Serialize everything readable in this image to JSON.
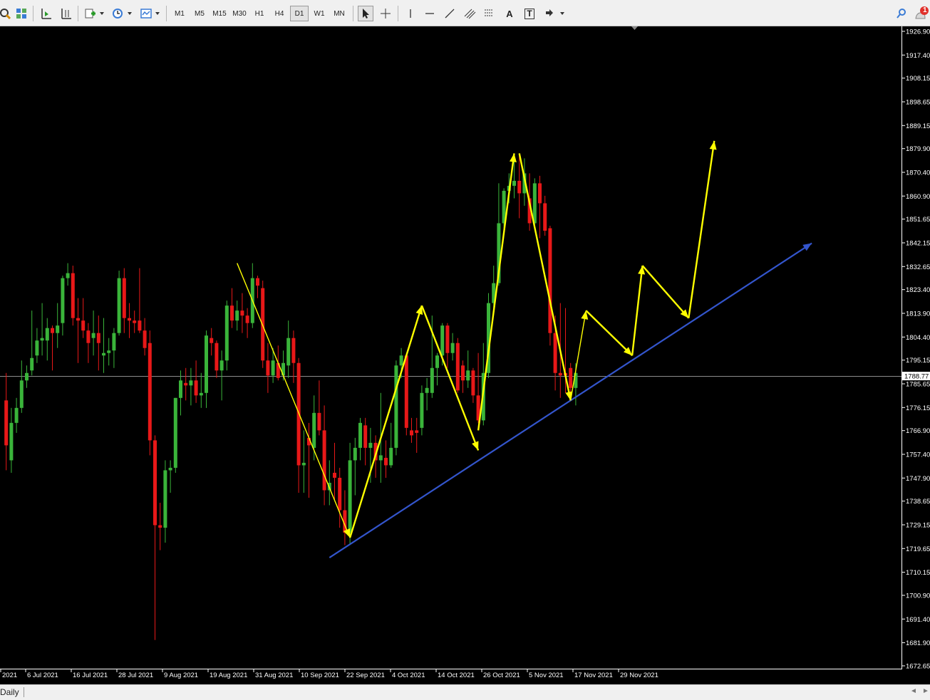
{
  "toolbar": {
    "timeframes": [
      "M1",
      "M5",
      "M15",
      "M30",
      "H1",
      "H4",
      "D1",
      "W1",
      "MN"
    ],
    "active_timeframe": "D1",
    "text_tool": "A",
    "label_tool": "T",
    "notification_count": "1"
  },
  "status": {
    "tab_label": "Daily"
  },
  "colors": {
    "background": "#000000",
    "bull": "#3ab43a",
    "bear": "#e81818",
    "arrows": "#ffff00",
    "trendline": "#3355cc",
    "grid_line": "#bbbbbb"
  },
  "chart_data": {
    "type": "candlestick",
    "x_axis_labels": [
      "2021",
      "6 Jul 2021",
      "16 Jul 2021",
      "28 Jul 2021",
      "9 Aug 2021",
      "19 Aug 2021",
      "31 Aug 2021",
      "10 Sep 2021",
      "22 Sep 2021",
      "4 Oct 2021",
      "14 Oct 2021",
      "26 Oct 2021",
      "5 Nov 2021",
      "17 Nov 2021",
      "29 Nov 2021"
    ],
    "y_axis_ticks": [
      "1926.90",
      "1917.40",
      "1908.15",
      "1898.65",
      "1889.15",
      "1879.90",
      "1870.40",
      "1860.90",
      "1851.65",
      "1842.15",
      "1832.65",
      "1823.40",
      "1813.90",
      "1804.40",
      "1795.15",
      "1785.65",
      "1776.15",
      "1766.90",
      "1757.40",
      "1747.90",
      "1738.65",
      "1729.15",
      "1719.65",
      "1710.15",
      "1700.90",
      "1691.40",
      "1681.90",
      "1672.65"
    ],
    "ylim": [
      1672.65,
      1926.9
    ],
    "current_price": "1788.77",
    "candles": [
      {
        "x": "2021-06-29",
        "o": 1779,
        "h": 1790,
        "l": 1751,
        "c": 1761
      },
      {
        "x": "2021-06-30",
        "o": 1755,
        "h": 1776,
        "l": 1750,
        "c": 1770
      },
      {
        "x": "2021-07-01",
        "o": 1770,
        "h": 1780,
        "l": 1766,
        "c": 1776
      },
      {
        "x": "2021-07-02",
        "o": 1776,
        "h": 1795,
        "l": 1774,
        "c": 1787
      },
      {
        "x": "2021-07-05",
        "o": 1787,
        "h": 1793,
        "l": 1784,
        "c": 1790
      },
      {
        "x": "2021-07-06",
        "o": 1791,
        "h": 1815,
        "l": 1789,
        "c": 1796
      },
      {
        "x": "2021-07-07",
        "o": 1797,
        "h": 1808,
        "l": 1794,
        "c": 1803
      },
      {
        "x": "2021-07-08",
        "o": 1803,
        "h": 1818,
        "l": 1797,
        "c": 1804
      },
      {
        "x": "2021-07-09",
        "o": 1803,
        "h": 1812,
        "l": 1795,
        "c": 1808
      },
      {
        "x": "2021-07-12",
        "o": 1808,
        "h": 1809,
        "l": 1791,
        "c": 1806
      },
      {
        "x": "2021-07-13",
        "o": 1806,
        "h": 1818,
        "l": 1800,
        "c": 1809
      },
      {
        "x": "2021-07-14",
        "o": 1810,
        "h": 1829,
        "l": 1805,
        "c": 1828
      },
      {
        "x": "2021-07-15",
        "o": 1828,
        "h": 1834,
        "l": 1825,
        "c": 1830
      },
      {
        "x": "2021-07-16",
        "o": 1830,
        "h": 1833,
        "l": 1809,
        "c": 1812
      },
      {
        "x": "2021-07-19",
        "o": 1812,
        "h": 1820,
        "l": 1794,
        "c": 1811
      },
      {
        "x": "2021-07-20",
        "o": 1811,
        "h": 1820,
        "l": 1804,
        "c": 1807
      },
      {
        "x": "2021-07-21",
        "o": 1807,
        "h": 1810,
        "l": 1794,
        "c": 1802
      },
      {
        "x": "2021-07-22",
        "o": 1804,
        "h": 1815,
        "l": 1797,
        "c": 1806
      },
      {
        "x": "2021-07-23",
        "o": 1806,
        "h": 1813,
        "l": 1791,
        "c": 1802
      },
      {
        "x": "2021-07-26",
        "o": 1797,
        "h": 1812,
        "l": 1790,
        "c": 1798
      },
      {
        "x": "2021-07-27",
        "o": 1798,
        "h": 1804,
        "l": 1793,
        "c": 1799
      },
      {
        "x": "2021-07-28",
        "o": 1799,
        "h": 1808,
        "l": 1792,
        "c": 1806
      },
      {
        "x": "2021-07-29",
        "o": 1806,
        "h": 1831,
        "l": 1805,
        "c": 1828
      },
      {
        "x": "2021-07-30",
        "o": 1828,
        "h": 1832,
        "l": 1806,
        "c": 1812
      },
      {
        "x": "2021-08-02",
        "o": 1812,
        "h": 1818,
        "l": 1804,
        "c": 1811
      },
      {
        "x": "2021-08-03",
        "o": 1811,
        "h": 1815,
        "l": 1806,
        "c": 1810
      },
      {
        "x": "2021-08-04",
        "o": 1811,
        "h": 1832,
        "l": 1806,
        "c": 1807
      },
      {
        "x": "2021-08-05",
        "o": 1807,
        "h": 1812,
        "l": 1797,
        "c": 1800
      },
      {
        "x": "2021-08-06",
        "o": 1802,
        "h": 1807,
        "l": 1757,
        "c": 1763
      },
      {
        "x": "2021-08-09",
        "o": 1763,
        "h": 1765,
        "l": 1683,
        "c": 1729
      },
      {
        "x": "2021-08-10",
        "o": 1729,
        "h": 1738,
        "l": 1719,
        "c": 1728
      },
      {
        "x": "2021-08-11",
        "o": 1728,
        "h": 1755,
        "l": 1722,
        "c": 1751
      },
      {
        "x": "2021-08-12",
        "o": 1751,
        "h": 1755,
        "l": 1742,
        "c": 1752
      },
      {
        "x": "2021-08-13",
        "o": 1752,
        "h": 1780,
        "l": 1750,
        "c": 1780
      },
      {
        "x": "2021-08-16",
        "o": 1780,
        "h": 1791,
        "l": 1773,
        "c": 1787
      },
      {
        "x": "2021-08-17",
        "o": 1786,
        "h": 1792,
        "l": 1779,
        "c": 1785
      },
      {
        "x": "2021-08-18",
        "o": 1785,
        "h": 1792,
        "l": 1777,
        "c": 1787
      },
      {
        "x": "2021-08-19",
        "o": 1787,
        "h": 1795,
        "l": 1778,
        "c": 1781
      },
      {
        "x": "2021-08-20",
        "o": 1781,
        "h": 1790,
        "l": 1776,
        "c": 1782
      },
      {
        "x": "2021-08-23",
        "o": 1782,
        "h": 1807,
        "l": 1776,
        "c": 1805
      },
      {
        "x": "2021-08-24",
        "o": 1804,
        "h": 1808,
        "l": 1797,
        "c": 1802
      },
      {
        "x": "2021-08-25",
        "o": 1802,
        "h": 1803,
        "l": 1788,
        "c": 1791
      },
      {
        "x": "2021-08-26",
        "o": 1791,
        "h": 1799,
        "l": 1779,
        "c": 1795
      },
      {
        "x": "2021-08-27",
        "o": 1795,
        "h": 1819,
        "l": 1791,
        "c": 1817
      },
      {
        "x": "2021-08-30",
        "o": 1817,
        "h": 1824,
        "l": 1808,
        "c": 1811
      },
      {
        "x": "2021-08-31",
        "o": 1811,
        "h": 1819,
        "l": 1807,
        "c": 1815
      },
      {
        "x": "2021-09-01",
        "o": 1815,
        "h": 1822,
        "l": 1806,
        "c": 1813
      },
      {
        "x": "2021-09-02",
        "o": 1813,
        "h": 1816,
        "l": 1804,
        "c": 1810
      },
      {
        "x": "2021-09-03",
        "o": 1810,
        "h": 1834,
        "l": 1808,
        "c": 1828
      },
      {
        "x": "2021-09-06",
        "o": 1828,
        "h": 1829,
        "l": 1820,
        "c": 1825
      },
      {
        "x": "2021-09-07",
        "o": 1824,
        "h": 1827,
        "l": 1792,
        "c": 1795
      },
      {
        "x": "2021-09-08",
        "o": 1795,
        "h": 1802,
        "l": 1782,
        "c": 1789
      },
      {
        "x": "2021-09-09",
        "o": 1789,
        "h": 1800,
        "l": 1786,
        "c": 1795
      },
      {
        "x": "2021-09-10",
        "o": 1794,
        "h": 1801,
        "l": 1787,
        "c": 1788
      },
      {
        "x": "2021-09-13",
        "o": 1789,
        "h": 1799,
        "l": 1787,
        "c": 1794
      },
      {
        "x": "2021-09-14",
        "o": 1793,
        "h": 1811,
        "l": 1788,
        "c": 1804
      },
      {
        "x": "2021-09-15",
        "o": 1804,
        "h": 1807,
        "l": 1786,
        "c": 1794
      },
      {
        "x": "2021-09-16",
        "o": 1794,
        "h": 1796,
        "l": 1742,
        "c": 1753
      },
      {
        "x": "2021-09-17",
        "o": 1753,
        "h": 1767,
        "l": 1742,
        "c": 1754
      },
      {
        "x": "2021-09-20",
        "o": 1764,
        "h": 1770,
        "l": 1740,
        "c": 1761
      },
      {
        "x": "2021-09-21",
        "o": 1760,
        "h": 1781,
        "l": 1755,
        "c": 1774
      },
      {
        "x": "2021-09-22",
        "o": 1774,
        "h": 1787,
        "l": 1765,
        "c": 1767
      },
      {
        "x": "2021-09-23",
        "o": 1767,
        "h": 1777,
        "l": 1737,
        "c": 1743
      },
      {
        "x": "2021-09-24",
        "o": 1743,
        "h": 1755,
        "l": 1737,
        "c": 1746
      },
      {
        "x": "2021-09-27",
        "o": 1750,
        "h": 1762,
        "l": 1739,
        "c": 1748
      },
      {
        "x": "2021-09-28",
        "o": 1748,
        "h": 1752,
        "l": 1728,
        "c": 1735
      },
      {
        "x": "2021-09-29",
        "o": 1735,
        "h": 1743,
        "l": 1721,
        "c": 1726
      },
      {
        "x": "2021-09-30",
        "o": 1726,
        "h": 1762,
        "l": 1721,
        "c": 1755
      },
      {
        "x": "2021-10-01",
        "o": 1755,
        "h": 1764,
        "l": 1741,
        "c": 1760
      },
      {
        "x": "2021-10-04",
        "o": 1760,
        "h": 1772,
        "l": 1755,
        "c": 1770
      },
      {
        "x": "2021-10-05",
        "o": 1769,
        "h": 1772,
        "l": 1753,
        "c": 1760
      },
      {
        "x": "2021-10-06",
        "o": 1760,
        "h": 1768,
        "l": 1746,
        "c": 1762
      },
      {
        "x": "2021-10-07",
        "o": 1762,
        "h": 1765,
        "l": 1748,
        "c": 1755
      },
      {
        "x": "2021-10-08",
        "o": 1755,
        "h": 1782,
        "l": 1746,
        "c": 1757
      },
      {
        "x": "2021-10-11",
        "o": 1756,
        "h": 1763,
        "l": 1748,
        "c": 1753
      },
      {
        "x": "2021-10-12",
        "o": 1753,
        "h": 1770,
        "l": 1752,
        "c": 1760
      },
      {
        "x": "2021-10-13",
        "o": 1760,
        "h": 1795,
        "l": 1757,
        "c": 1793
      },
      {
        "x": "2021-10-14",
        "o": 1793,
        "h": 1800,
        "l": 1788,
        "c": 1797
      },
      {
        "x": "2021-10-15",
        "o": 1797,
        "h": 1798,
        "l": 1765,
        "c": 1768
      },
      {
        "x": "2021-10-18",
        "o": 1767,
        "h": 1772,
        "l": 1762,
        "c": 1765
      },
      {
        "x": "2021-10-19",
        "o": 1767,
        "h": 1772,
        "l": 1758,
        "c": 1766
      },
      {
        "x": "2021-10-20",
        "o": 1768,
        "h": 1785,
        "l": 1765,
        "c": 1782
      },
      {
        "x": "2021-10-21",
        "o": 1782,
        "h": 1788,
        "l": 1775,
        "c": 1784
      },
      {
        "x": "2021-10-22",
        "o": 1782,
        "h": 1813,
        "l": 1780,
        "c": 1792
      },
      {
        "x": "2021-10-25",
        "o": 1792,
        "h": 1798,
        "l": 1785,
        "c": 1797
      },
      {
        "x": "2021-10-26",
        "o": 1797,
        "h": 1810,
        "l": 1793,
        "c": 1809
      },
      {
        "x": "2021-10-27",
        "o": 1809,
        "h": 1810,
        "l": 1792,
        "c": 1798
      },
      {
        "x": "2021-10-28",
        "o": 1798,
        "h": 1806,
        "l": 1795,
        "c": 1802
      },
      {
        "x": "2021-10-29",
        "o": 1802,
        "h": 1804,
        "l": 1782,
        "c": 1783
      },
      {
        "x": "2021-11-01",
        "o": 1793,
        "h": 1795,
        "l": 1782,
        "c": 1787
      },
      {
        "x": "2021-11-02",
        "o": 1787,
        "h": 1799,
        "l": 1784,
        "c": 1791
      },
      {
        "x": "2021-11-03",
        "o": 1791,
        "h": 1792,
        "l": 1778,
        "c": 1781
      },
      {
        "x": "2021-11-04",
        "o": 1781,
        "h": 1798,
        "l": 1770,
        "c": 1771
      },
      {
        "x": "2021-11-05",
        "o": 1771,
        "h": 1802,
        "l": 1769,
        "c": 1790
      },
      {
        "x": "2021-11-08",
        "o": 1790,
        "h": 1822,
        "l": 1788,
        "c": 1818
      },
      {
        "x": "2021-11-09",
        "o": 1818,
        "h": 1833,
        "l": 1814,
        "c": 1826
      },
      {
        "x": "2021-11-10",
        "o": 1826,
        "h": 1866,
        "l": 1825,
        "c": 1850
      },
      {
        "x": "2021-11-11",
        "o": 1850,
        "h": 1864,
        "l": 1846,
        "c": 1863
      },
      {
        "x": "2021-11-12",
        "o": 1863,
        "h": 1870,
        "l": 1858,
        "c": 1865
      },
      {
        "x": "2021-11-15",
        "o": 1865,
        "h": 1877,
        "l": 1860,
        "c": 1867
      },
      {
        "x": "2021-11-16",
        "o": 1867,
        "h": 1877,
        "l": 1852,
        "c": 1862
      },
      {
        "x": "2021-11-17",
        "o": 1862,
        "h": 1876,
        "l": 1857,
        "c": 1870
      },
      {
        "x": "2021-11-18",
        "o": 1860,
        "h": 1870,
        "l": 1847,
        "c": 1850
      },
      {
        "x": "2021-11-19",
        "o": 1850,
        "h": 1868,
        "l": 1848,
        "c": 1866
      },
      {
        "x": "2021-11-22",
        "o": 1866,
        "h": 1869,
        "l": 1844,
        "c": 1858
      },
      {
        "x": "2021-11-23",
        "o": 1858,
        "h": 1861,
        "l": 1845,
        "c": 1847
      },
      {
        "x": "2021-11-24",
        "o": 1848,
        "h": 1849,
        "l": 1801,
        "c": 1806
      },
      {
        "x": "2021-11-25",
        "o": 1806,
        "h": 1813,
        "l": 1783,
        "c": 1790
      },
      {
        "x": "2021-11-26",
        "o": 1790,
        "h": 1818,
        "l": 1780,
        "c": 1789
      },
      {
        "x": "2021-11-29",
        "o": 1790,
        "h": 1816,
        "l": 1782,
        "c": 1789
      },
      {
        "x": "2021-11-30",
        "o": 1792,
        "h": 1794,
        "l": 1782,
        "c": 1784
      },
      {
        "x": "2021-12-01",
        "o": 1784,
        "h": 1794,
        "l": 1777,
        "c": 1790
      }
    ],
    "annotation_arrows": [
      {
        "from": [
          "2021-08-31",
          1834
        ],
        "to": [
          "2021-09-30",
          1724
        ],
        "color": "yellow"
      },
      {
        "from": [
          "2021-09-30",
          1724
        ],
        "to": [
          "2021-10-20",
          1817
        ],
        "color": "yellow"
      },
      {
        "from": [
          "2021-10-20",
          1817
        ],
        "to": [
          "2021-11-04",
          1759
        ],
        "color": "yellow"
      },
      {
        "from": [
          "2021-11-04",
          1767
        ],
        "to": [
          "2021-11-15",
          1878
        ],
        "color": "yellow"
      },
      {
        "from": [
          "2021-11-16",
          1878
        ],
        "to": [
          "2021-11-30",
          1779
        ],
        "color": "yellow"
      },
      {
        "from": [
          "2021-11-30",
          1779
        ],
        "to": [
          "2021-12-03",
          1815
        ],
        "color": "yellow"
      },
      {
        "from": [
          "2021-12-03",
          1815
        ],
        "to": [
          "2021-12-16",
          1797
        ],
        "color": "yellow"
      },
      {
        "from": [
          "2021-12-16",
          1797
        ],
        "to": [
          "2021-12-20",
          1833
        ],
        "color": "yellow"
      },
      {
        "from": [
          "2021-12-20",
          1833
        ],
        "to": [
          "2021-12-31",
          1812
        ],
        "color": "yellow"
      },
      {
        "from": [
          "2021-12-31",
          1812
        ],
        "to": [
          "2022-01-07",
          1883
        ],
        "color": "yellow"
      }
    ],
    "trendline": {
      "from": [
        "2021-09-24",
        1716
      ],
      "to": [
        "2022-02-03",
        1842
      ],
      "color": "blue"
    }
  }
}
